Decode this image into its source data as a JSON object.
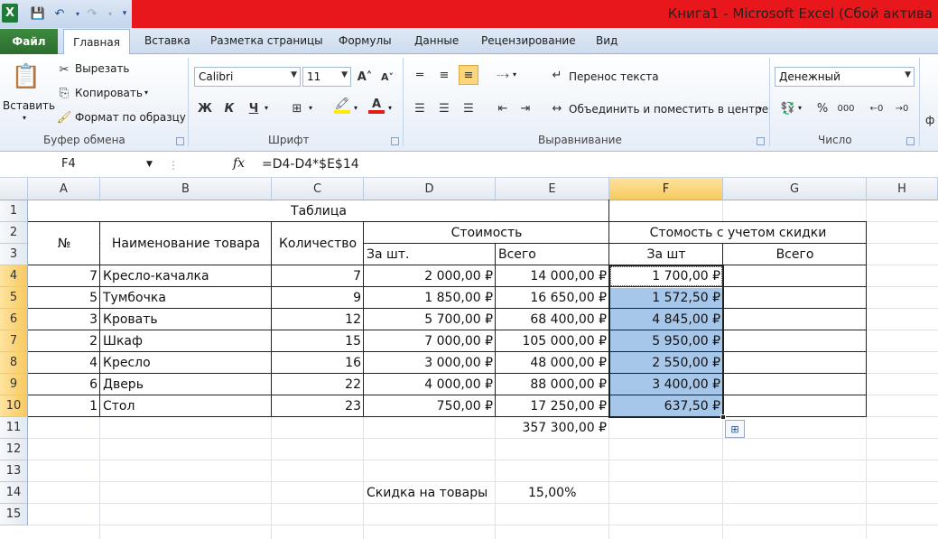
{
  "titlebar": {
    "title": "Книга1  -  Microsoft Excel (Сбой актива",
    "logo": "X"
  },
  "tabs": {
    "file": "Файл",
    "items": [
      "Главная",
      "Вставка",
      "Разметка страницы",
      "Формулы",
      "Данные",
      "Рецензирование",
      "Вид"
    ]
  },
  "ribbon": {
    "paste": "Вставить",
    "cut": "Вырезать",
    "copy": "Копировать",
    "format_painter": "Формат по образцу",
    "group_clipboard": "Буфер обмена",
    "font_name": "Calibri",
    "font_size": "11",
    "bold": "Ж",
    "italic": "К",
    "underline": "Ч",
    "group_font": "Шрифт",
    "wrap_text": "Перенос текста",
    "merge_center": "Объединить и поместить в центре",
    "group_alignment": "Выравнивание",
    "number_format": "Денежный",
    "percent": "%",
    "thousands": "000",
    "group_number": "Число",
    "group_cut_off": "ф"
  },
  "formula_bar": {
    "cell_ref": "F4",
    "fx": "fx",
    "formula": "=D4-D4*$E$14"
  },
  "grid": {
    "columns": [
      "A",
      "B",
      "C",
      "D",
      "E",
      "F",
      "G",
      "H"
    ],
    "selected_column": "F",
    "rows": [
      "1",
      "2",
      "3",
      "4",
      "5",
      "6",
      "7",
      "8",
      "9",
      "10",
      "11",
      "12",
      "13",
      "14",
      "15"
    ],
    "selected_rows": [
      "4",
      "5",
      "6",
      "7",
      "8",
      "9",
      "10"
    ],
    "header": {
      "title": "Таблица",
      "num": "№",
      "name": "Наименование товара",
      "qty": "Количество",
      "cost": "Стоимость",
      "cost_discount": "Стомость с учетом скидки",
      "per_unit": "За шт.",
      "total": "Всего",
      "per_unit2": "За шт",
      "total2": "Всего"
    },
    "data_rows": [
      {
        "num": "7",
        "name": "Кресло-качалка",
        "qty": "7",
        "price": "2 000,00 ₽",
        "sum": "14 000,00 ₽",
        "disc": "1 700,00 ₽"
      },
      {
        "num": "5",
        "name": "Тумбочка",
        "qty": "9",
        "price": "1 850,00 ₽",
        "sum": "16 650,00 ₽",
        "disc": "1 572,50 ₽"
      },
      {
        "num": "3",
        "name": "Кровать",
        "qty": "12",
        "price": "5 700,00 ₽",
        "sum": "68 400,00 ₽",
        "disc": "4 845,00 ₽"
      },
      {
        "num": "2",
        "name": "Шкаф",
        "qty": "15",
        "price": "7 000,00 ₽",
        "sum": "105 000,00 ₽",
        "disc": "5 950,00 ₽"
      },
      {
        "num": "4",
        "name": "Кресло",
        "qty": "16",
        "price": "3 000,00 ₽",
        "sum": "48 000,00 ₽",
        "disc": "2 550,00 ₽"
      },
      {
        "num": "6",
        "name": "Дверь",
        "qty": "22",
        "price": "4 000,00 ₽",
        "sum": "88 000,00 ₽",
        "disc": "3 400,00 ₽"
      },
      {
        "num": "1",
        "name": "Стол",
        "qty": "23",
        "price": "750,00 ₽",
        "sum": "17 250,00 ₽",
        "disc": "637,50 ₽"
      }
    ],
    "grand_total": "357 300,00 ₽",
    "discount_label": "Скидка на товары",
    "discount_value": "15,00%"
  }
}
